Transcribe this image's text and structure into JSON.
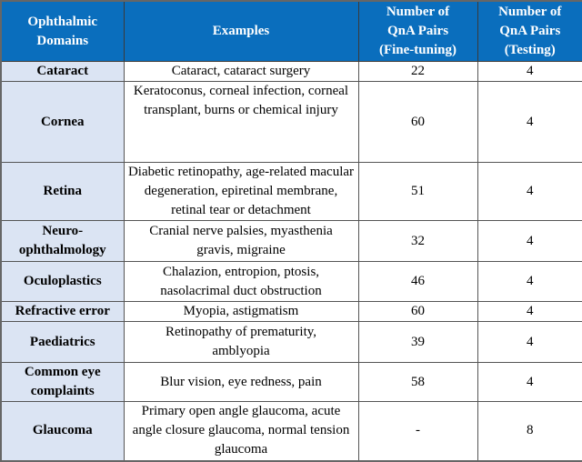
{
  "table": {
    "headers": [
      "Ophthalmic Domains",
      "Examples",
      "Number of QnA Pairs (Fine-tuning)",
      "Number of QnA Pairs (Testing)"
    ],
    "header_lines": [
      [
        "Ophthalmic",
        "Domains"
      ],
      [
        "Examples"
      ],
      [
        "Number of",
        "QnA Pairs",
        "(Fine-tuning)"
      ],
      [
        "Number of",
        "QnA Pairs",
        "(Testing)"
      ]
    ],
    "rows": [
      {
        "domain": "Cataract",
        "examples": "Cataract, cataract surgery",
        "fine_tuning": "22",
        "testing": "4"
      },
      {
        "domain": "Cornea",
        "examples": "Keratoconus, corneal infection, corneal transplant, burns or chemical injury",
        "fine_tuning": "60",
        "testing": "4"
      },
      {
        "domain": "Retina",
        "examples": "Diabetic retinopathy, age-related macular degeneration, epiretinal membrane, retinal tear or detachment",
        "fine_tuning": "51",
        "testing": "4"
      },
      {
        "domain": "Neuro-ophthalmology",
        "examples": "Cranial nerve palsies, myasthenia gravis, migraine",
        "fine_tuning": "32",
        "testing": "4"
      },
      {
        "domain": "Oculoplastics",
        "examples": "Chalazion, entropion, ptosis, nasolacrimal duct obstruction",
        "fine_tuning": "46",
        "testing": "4"
      },
      {
        "domain": "Refractive error",
        "examples": "Myopia, astigmatism",
        "fine_tuning": "60",
        "testing": "4"
      },
      {
        "domain": "Paediatrics",
        "examples": "Retinopathy of prematurity, amblyopia",
        "fine_tuning": "39",
        "testing": "4"
      },
      {
        "domain": "Common eye complaints",
        "examples": "Blur vision, eye redness, pain",
        "fine_tuning": "58",
        "testing": "4"
      },
      {
        "domain": "Glaucoma",
        "examples": "Primary open angle glaucoma, acute angle closure glaucoma, normal tension glaucoma",
        "fine_tuning": "-",
        "testing": "8"
      }
    ],
    "colors": {
      "header_bg": "#0a6ebd",
      "header_text": "#ffffff",
      "domain_bg": "#dbe4f3",
      "border": "#555555"
    }
  }
}
